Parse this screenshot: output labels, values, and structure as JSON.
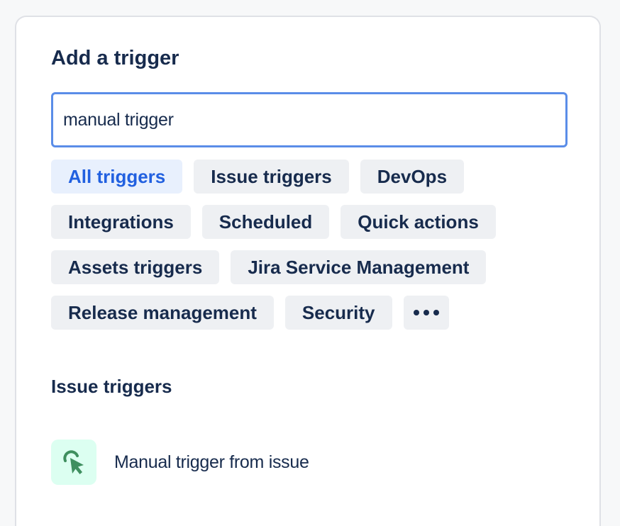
{
  "panel": {
    "title": "Add a trigger"
  },
  "search": {
    "value": "manual trigger"
  },
  "filters": {
    "active": "All triggers",
    "rows": [
      [
        "All triggers",
        "Issue triggers",
        "DevOps"
      ],
      [
        "Integrations",
        "Scheduled",
        "Quick actions"
      ],
      [
        "Assets triggers",
        "Jira Service Management"
      ],
      [
        "Release management",
        "Security"
      ]
    ],
    "more_icon": "ellipsis-icon"
  },
  "results": {
    "section_heading": "Issue triggers",
    "items": [
      {
        "label": "Manual trigger from issue",
        "icon": "cursor-click-icon",
        "icon_color": "#3f8f5f",
        "icon_bg": "#dcfff1"
      }
    ]
  },
  "colors": {
    "accent": "#2160e0",
    "focus_border": "#5a8de8",
    "chip_bg": "#eef0f3",
    "chip_active_bg": "#e8f0fd",
    "text": "#172b4d"
  }
}
